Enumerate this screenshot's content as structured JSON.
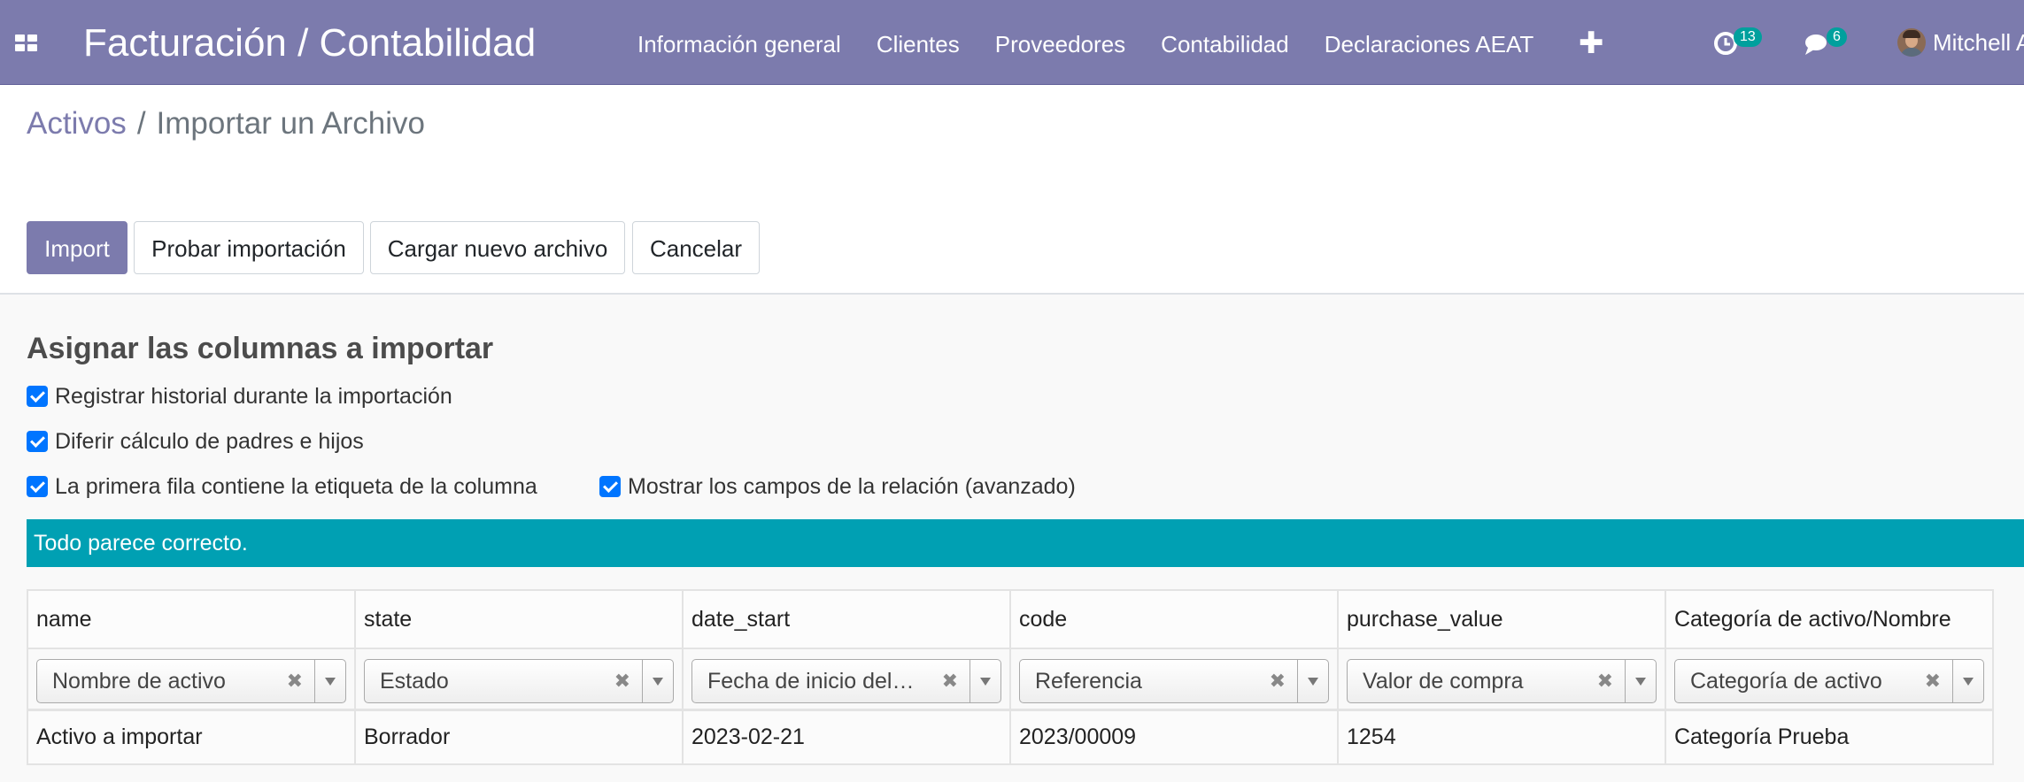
{
  "navbar": {
    "title": "Facturación / Contabilidad",
    "menu": [
      "Información general",
      "Clientes",
      "Proveedores",
      "Contabilidad",
      "Declaraciones AEAT"
    ],
    "activity_count": "13",
    "message_count": "6",
    "user_name": "Mitchell Admin"
  },
  "breadcrumb": {
    "parent": "Activos",
    "separator": "/",
    "current": "Importar un Archivo"
  },
  "buttons": {
    "import": "Import",
    "test": "Probar importación",
    "load_new": "Cargar nuevo archivo",
    "cancel": "Cancelar"
  },
  "section_title": "Asignar las columnas a importar",
  "options": {
    "track_history": "Registrar historial durante la importación",
    "defer_parent": "Diferir cálculo de padres e hijos",
    "first_row_headers": "La primera fila contiene la etiqueta de la columna",
    "show_relation_fields": "Mostrar los campos de la relación (avanzado)"
  },
  "alert": "Todo parece correcto.",
  "table": {
    "columns": [
      {
        "header": "name",
        "field": "Nombre de activo",
        "value": "Activo a importar"
      },
      {
        "header": "state",
        "field": "Estado",
        "value": "Borrador"
      },
      {
        "header": "date_start",
        "field": "Fecha de inicio del…",
        "value": "2023-02-21"
      },
      {
        "header": "code",
        "field": "Referencia",
        "value": "2023/00009"
      },
      {
        "header": "purchase_value",
        "field": "Valor de compra",
        "value": "1254"
      },
      {
        "header": "Categoría de activo/Nombre",
        "field": "Categoría de activo",
        "value": "Categoría Prueba"
      }
    ]
  },
  "icons": {
    "apps": "apps-grid-icon",
    "plus": "plus-icon",
    "activity": "clock-icon",
    "messages": "chat-icon",
    "clear": "clear-icon",
    "dropdown": "chevron-down-icon"
  },
  "colors": {
    "brand": "#7c7bad",
    "alert": "#00a0b3",
    "badge": "#00a09d",
    "checkbox": "#0075ff"
  }
}
